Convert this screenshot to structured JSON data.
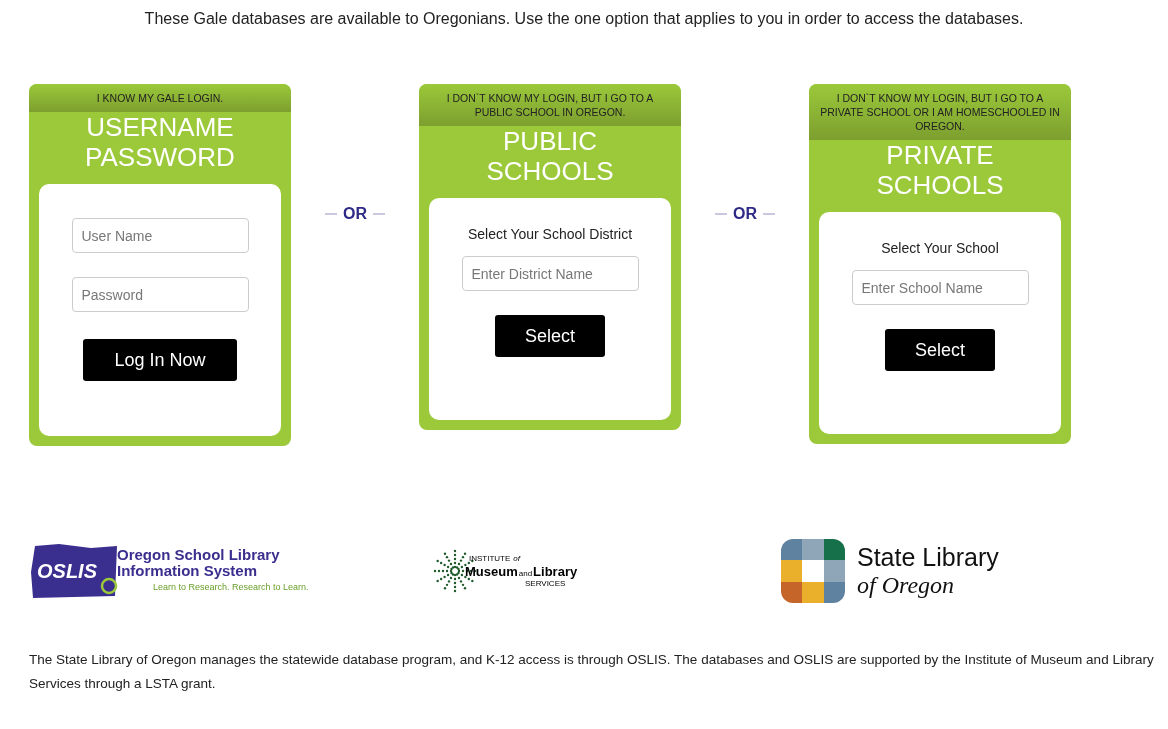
{
  "intro": "These Gale databases are available to Oregonians. Use the one option that applies to you in order to access the databases.",
  "cards": [
    {
      "kind": "login",
      "prompt": "I KNOW MY GALE LOGIN.",
      "title": [
        "USERNAME",
        "PASSWORD"
      ],
      "fields": [
        {
          "placeholder": "User Name"
        },
        {
          "placeholder": "Password"
        }
      ],
      "button": "Log In Now"
    },
    {
      "kind": "select",
      "prompt": "I DON`T KNOW MY LOGIN, BUT I GO TO A PUBLIC SCHOOL IN OREGON.",
      "title": [
        "PUBLIC",
        "SCHOOLS"
      ],
      "label": "Select Your School District",
      "fields": [
        {
          "placeholder": "Enter District Name"
        }
      ],
      "button": "Select"
    },
    {
      "kind": "select",
      "prompt": "I DON`T KNOW MY LOGIN, BUT I GO TO A PRIVATE SCHOOL OR I AM HOMESCHOOLED IN OREGON.",
      "title": [
        "PRIVATE",
        "SCHOOLS"
      ],
      "label": "Select Your School",
      "fields": [
        {
          "placeholder": "Enter School Name"
        }
      ],
      "button": "Select"
    }
  ],
  "separators": [
    "OR",
    "OR"
  ],
  "logos": {
    "oslis": {
      "badge": "OSLIS",
      "name": [
        "Oregon School Library",
        "Information System"
      ],
      "tagline": "Learn to Research. Research to Learn."
    },
    "imls": {
      "top": "INSTITUTE",
      "of": "of",
      "museum": "Museum",
      "and": "and",
      "library": "Library",
      "services": "SERVICES"
    },
    "state_library": {
      "name": "State Library",
      "sub": "of Oregon"
    }
  },
  "footer": "The State Library of Oregon manages the statewide database program, and K-12 access is through OSLIS. The databases and OSLIS are supported by the Institute of Museum and Library Services through a LSTA grant."
}
